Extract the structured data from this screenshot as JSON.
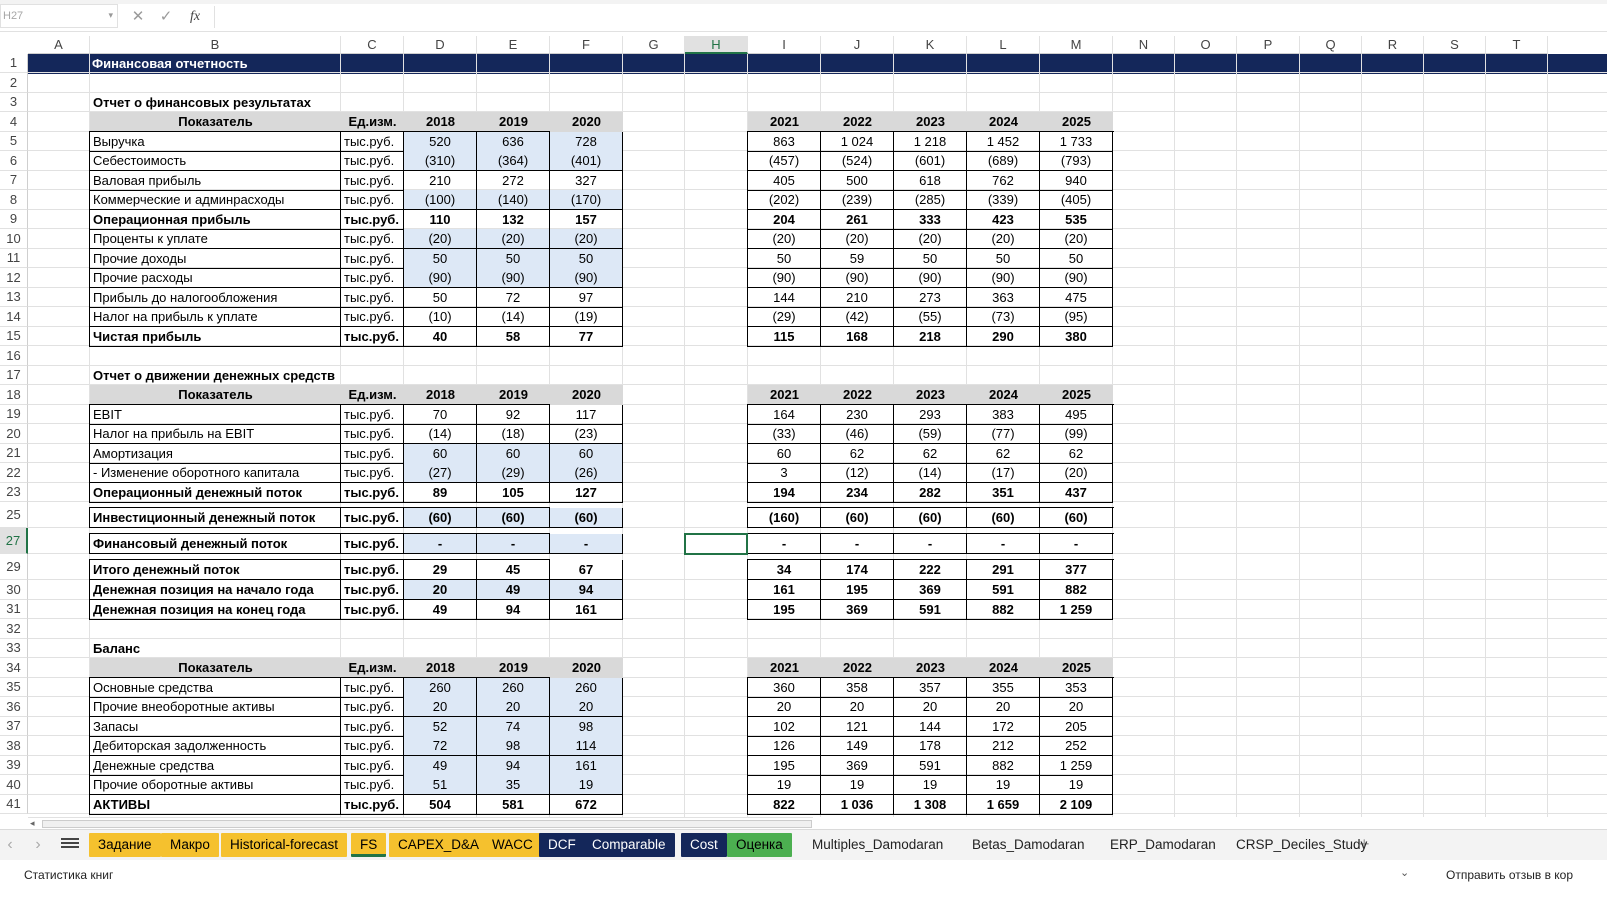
{
  "namebox": "H27",
  "formula_buttons": {
    "cancel": "✕",
    "confirm": "✓",
    "fx": "fx"
  },
  "columns": [
    "A",
    "B",
    "C",
    "D",
    "E",
    "F",
    "G",
    "H",
    "I",
    "J",
    "K",
    "L",
    "M",
    "N",
    "O",
    "P",
    "Q",
    "R",
    "S",
    "T"
  ],
  "rows": [
    "1",
    "2",
    "3",
    "4",
    "5",
    "6",
    "7",
    "8",
    "9",
    "10",
    "11",
    "12",
    "13",
    "14",
    "15",
    "16",
    "17",
    "18",
    "19",
    "20",
    "21",
    "22",
    "23",
    "25",
    "27",
    "29",
    "30",
    "31",
    "32",
    "33",
    "34",
    "35",
    "36",
    "37",
    "38",
    "39",
    "40",
    "41"
  ],
  "selected_col": "H",
  "selected_row": "27",
  "title": "Финансовая отчетность",
  "sections": [
    {
      "title": "Отчет о финансовых результатах",
      "header": {
        "label": "Показатель",
        "unit": "Ед.изм.",
        "years_hist": [
          "2018",
          "2019",
          "2020"
        ],
        "years_fc": [
          "2021",
          "2022",
          "2023",
          "2024",
          "2025"
        ]
      },
      "rows": [
        {
          "label": "Выручка",
          "unit": "тыс.руб.",
          "bold": false,
          "input": true,
          "hist": [
            "520",
            "636",
            "728"
          ],
          "fc": [
            "863",
            "1 024",
            "1 218",
            "1 452",
            "1 733"
          ]
        },
        {
          "label": "Себестоимость",
          "unit": "тыс.руб.",
          "bold": false,
          "input": true,
          "hist": [
            "(310)",
            "(364)",
            "(401)"
          ],
          "fc": [
            "(457)",
            "(524)",
            "(601)",
            "(689)",
            "(793)"
          ]
        },
        {
          "label": "Валовая прибыль",
          "unit": "тыс.руб.",
          "bold": false,
          "input": false,
          "hist": [
            "210",
            "272",
            "327"
          ],
          "fc": [
            "405",
            "500",
            "618",
            "762",
            "940"
          ]
        },
        {
          "label": "Коммерческие и админрасходы",
          "unit": "тыс.руб.",
          "bold": false,
          "input": true,
          "hist": [
            "(100)",
            "(140)",
            "(170)"
          ],
          "fc": [
            "(202)",
            "(239)",
            "(285)",
            "(339)",
            "(405)"
          ]
        },
        {
          "label": "Операционная прибыль",
          "unit": "тыс.руб.",
          "bold": true,
          "input": false,
          "hist": [
            "110",
            "132",
            "157"
          ],
          "fc": [
            "204",
            "261",
            "333",
            "423",
            "535"
          ]
        },
        {
          "label": "Проценты к уплате",
          "unit": "тыс.руб.",
          "bold": false,
          "input": true,
          "hist": [
            "(20)",
            "(20)",
            "(20)"
          ],
          "fc": [
            "(20)",
            "(20)",
            "(20)",
            "(20)",
            "(20)"
          ]
        },
        {
          "label": "Прочие доходы",
          "unit": "тыс.руб.",
          "bold": false,
          "input": true,
          "hist": [
            "50",
            "50",
            "50"
          ],
          "fc": [
            "50",
            "59",
            "50",
            "50",
            "50"
          ]
        },
        {
          "label": "Прочие расходы",
          "unit": "тыс.руб.",
          "bold": false,
          "input": true,
          "hist": [
            "(90)",
            "(90)",
            "(90)"
          ],
          "fc": [
            "(90)",
            "(90)",
            "(90)",
            "(90)",
            "(90)"
          ]
        },
        {
          "label": "Прибыль до налогообложения",
          "unit": "тыс.руб.",
          "bold": false,
          "input": false,
          "hist": [
            "50",
            "72",
            "97"
          ],
          "fc": [
            "144",
            "210",
            "273",
            "363",
            "475"
          ]
        },
        {
          "label": "Налог на прибыль к уплате",
          "unit": "тыс.руб.",
          "bold": false,
          "input": false,
          "hist": [
            "(10)",
            "(14)",
            "(19)"
          ],
          "fc": [
            "(29)",
            "(42)",
            "(55)",
            "(73)",
            "(95)"
          ]
        },
        {
          "label": "Чистая прибыль",
          "unit": "тыс.руб.",
          "bold": true,
          "input": false,
          "hist": [
            "40",
            "58",
            "77"
          ],
          "fc": [
            "115",
            "168",
            "218",
            "290",
            "380"
          ]
        }
      ]
    },
    {
      "title": "Отчет о движении денежных средств",
      "header": {
        "label": "Показатель",
        "unit": "Ед.изм.",
        "years_hist": [
          "2018",
          "2019",
          "2020"
        ],
        "years_fc": [
          "2021",
          "2022",
          "2023",
          "2024",
          "2025"
        ]
      },
      "rows": [
        {
          "label": "EBIT",
          "unit": "тыс.руб.",
          "bold": false,
          "input": false,
          "hist": [
            "70",
            "92",
            "117"
          ],
          "fc": [
            "164",
            "230",
            "293",
            "383",
            "495"
          ]
        },
        {
          "label": "Налог на прибыль на EBIT",
          "unit": "тыс.руб.",
          "bold": false,
          "input": false,
          "hist": [
            "(14)",
            "(18)",
            "(23)"
          ],
          "fc": [
            "(33)",
            "(46)",
            "(59)",
            "(77)",
            "(99)"
          ]
        },
        {
          "label": "Амортизация",
          "unit": "тыс.руб.",
          "bold": false,
          "input": true,
          "hist": [
            "60",
            "60",
            "60"
          ],
          "fc": [
            "60",
            "62",
            "62",
            "62",
            "62"
          ]
        },
        {
          "label": " - Изменение оборотного капитала",
          "unit": "тыс.руб.",
          "bold": false,
          "input": true,
          "hist": [
            "(27)",
            "(29)",
            "(26)"
          ],
          "fc": [
            "3",
            "(12)",
            "(14)",
            "(17)",
            "(20)"
          ]
        },
        {
          "label": "Операционный денежный поток",
          "unit": "тыс.руб.",
          "bold": true,
          "input": false,
          "hist": [
            "89",
            "105",
            "127"
          ],
          "fc": [
            "194",
            "234",
            "282",
            "351",
            "437"
          ]
        },
        {
          "label": "Инвестиционный денежный поток",
          "unit": "тыс.руб.",
          "bold": true,
          "input": true,
          "hist": [
            "(60)",
            "(60)",
            "(60)"
          ],
          "fc": [
            "(160)",
            "(60)",
            "(60)",
            "(60)",
            "(60)"
          ]
        },
        {
          "label": "Финансовый денежный поток",
          "unit": "тыс.руб.",
          "bold": true,
          "input": true,
          "hist": [
            "-",
            "-",
            "-"
          ],
          "fc": [
            "-",
            "-",
            "-",
            "-",
            "-"
          ]
        },
        {
          "label": "Итого денежный поток",
          "unit": "тыс.руб.",
          "bold": true,
          "input": false,
          "hist": [
            "29",
            "45",
            "67"
          ],
          "fc": [
            "34",
            "174",
            "222",
            "291",
            "377"
          ]
        },
        {
          "label": "Денежная позиция на начало года",
          "unit": "тыс.руб.",
          "bold": true,
          "input": true,
          "hist": [
            "20",
            "49",
            "94"
          ],
          "fc": [
            "161",
            "195",
            "369",
            "591",
            "882"
          ]
        },
        {
          "label": "Денежная позиция на конец года",
          "unit": "тыс.руб.",
          "bold": true,
          "input": false,
          "hist": [
            "49",
            "94",
            "161"
          ],
          "fc": [
            "195",
            "369",
            "591",
            "882",
            "1 259"
          ]
        }
      ]
    },
    {
      "title": "Баланс",
      "header": {
        "label": "Показатель",
        "unit": "Ед.изм.",
        "years_hist": [
          "2018",
          "2019",
          "2020"
        ],
        "years_fc": [
          "2021",
          "2022",
          "2023",
          "2024",
          "2025"
        ]
      },
      "rows": [
        {
          "label": "Основные средства",
          "unit": "тыс.руб.",
          "bold": false,
          "input": true,
          "hist": [
            "260",
            "260",
            "260"
          ],
          "fc": [
            "360",
            "358",
            "357",
            "355",
            "353"
          ]
        },
        {
          "label": "Прочие внеоборотные активы",
          "unit": "тыс.руб.",
          "bold": false,
          "input": true,
          "hist": [
            "20",
            "20",
            "20"
          ],
          "fc": [
            "20",
            "20",
            "20",
            "20",
            "20"
          ]
        },
        {
          "label": "Запасы",
          "unit": "тыс.руб.",
          "bold": false,
          "input": true,
          "hist": [
            "52",
            "74",
            "98"
          ],
          "fc": [
            "102",
            "121",
            "144",
            "172",
            "205"
          ]
        },
        {
          "label": "Дебиторская задолженность",
          "unit": "тыс.руб.",
          "bold": false,
          "input": true,
          "hist": [
            "72",
            "98",
            "114"
          ],
          "fc": [
            "126",
            "149",
            "178",
            "212",
            "252"
          ]
        },
        {
          "label": "Денежные средства",
          "unit": "тыс.руб.",
          "bold": false,
          "input": true,
          "hist": [
            "49",
            "94",
            "161"
          ],
          "fc": [
            "195",
            "369",
            "591",
            "882",
            "1 259"
          ]
        },
        {
          "label": "Прочие оборотные активы",
          "unit": "тыс.руб.",
          "bold": false,
          "input": true,
          "hist": [
            "51",
            "35",
            "19"
          ],
          "fc": [
            "19",
            "19",
            "19",
            "19",
            "19"
          ]
        },
        {
          "label": "АКТИВЫ",
          "unit": "тыс.руб.",
          "bold": true,
          "input": false,
          "hist": [
            "504",
            "581",
            "672"
          ],
          "fc": [
            "822",
            "1 036",
            "1 308",
            "1 659",
            "2 109"
          ]
        }
      ]
    }
  ],
  "tabs": [
    {
      "label": "Задание",
      "bg": "#f5c12e",
      "fg": "#000",
      "active": false
    },
    {
      "label": "Макро",
      "bg": "#f5c12e",
      "fg": "#000",
      "active": false
    },
    {
      "label": "Historical-forecast",
      "bg": "#f5c12e",
      "fg": "#000",
      "active": false
    },
    {
      "label": "FS",
      "bg": "#f5c12e",
      "fg": "#000",
      "active": true
    },
    {
      "label": "CAPEX_D&A",
      "bg": "#f5c12e",
      "fg": "#000",
      "active": false
    },
    {
      "label": "WACC",
      "bg": "#f5c12e",
      "fg": "#000",
      "active": false
    },
    {
      "label": "DCF",
      "bg": "#14275a",
      "fg": "#fff",
      "active": false
    },
    {
      "label": "Comparable",
      "bg": "#14275a",
      "fg": "#fff",
      "active": false
    },
    {
      "label": "Cost",
      "bg": "#14275a",
      "fg": "#fff",
      "active": false
    },
    {
      "label": "Оценка",
      "bg": "#4caf50",
      "fg": "#000",
      "active": false
    },
    {
      "label": "Multiples_Damodaran",
      "bg": "transparent",
      "fg": "#222",
      "active": false
    },
    {
      "label": "Betas_Damodaran",
      "bg": "transparent",
      "fg": "#222",
      "active": false
    },
    {
      "label": "ERP_Damodaran",
      "bg": "transparent",
      "fg": "#222",
      "active": false
    },
    {
      "label": "CRSP_Deciles_Study",
      "bg": "transparent",
      "fg": "#222",
      "active": false
    }
  ],
  "add_tab": "+",
  "status_left": "Статистика книг",
  "status_right": "Отправить отзыв в кор",
  "colors": {
    "banner": "#14275a",
    "header_fill": "#d9d9d9",
    "input_fill": "#dde8f6",
    "accent": "#217346"
  }
}
